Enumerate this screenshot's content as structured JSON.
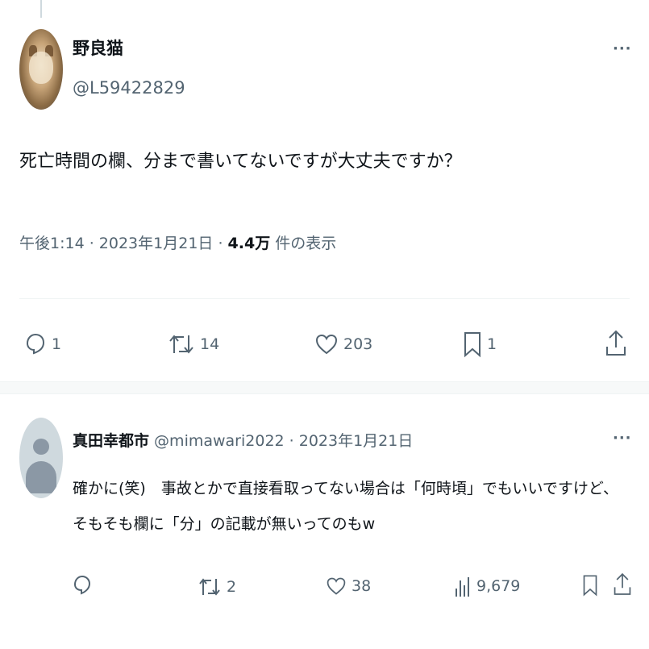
{
  "tweet": {
    "display_name": "野良猫",
    "handle": "@L59422829",
    "text": "死亡時間の欄、分まで書いてないですが大丈夫ですか？",
    "time": "午後1:14 · 2023年1月21日 · ",
    "views_count": "4.4万",
    "views_suffix": " 件の表示",
    "replies": "1",
    "retweets": "14",
    "likes": "203",
    "bookmarks": "1",
    "more_glyph": "···"
  },
  "reply": {
    "display_name": "真田幸都市",
    "meta": " @mimawari2022 · 2023年1月21日",
    "text": "確かに(笑)　事故とかで直接看取ってない場合は「何時頃」でもいいですけど、そもそも欄に「分」の記載が無いってのもw",
    "retweets": "2",
    "likes": "38",
    "views": "9,679",
    "more_glyph": "···"
  },
  "icons": [
    "reply-icon",
    "retweet-icon",
    "like-icon",
    "bookmark-icon",
    "share-icon",
    "views-icon",
    "more-icon"
  ],
  "colors": {
    "text": "#0f1419",
    "secondary": "#536471",
    "divider": "#eff3f4"
  }
}
